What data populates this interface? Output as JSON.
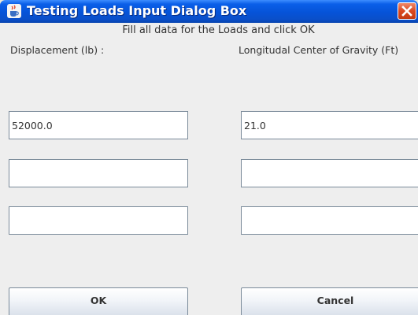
{
  "window": {
    "title": "Testing Loads Input Dialog Box",
    "title_icon": "java-cup-icon",
    "close_icon": "close-icon",
    "colors": {
      "titlebar": "#0653d8",
      "close": "#d9471f",
      "content": "#eeeeee"
    }
  },
  "form": {
    "instruction": "Fill all data for the Loads and click OK",
    "columns": {
      "displacement": {
        "label": "Displacement (lb) :"
      },
      "lcg": {
        "label": "Longitudal Center of Gravity (Ft)"
      }
    },
    "rows": [
      {
        "displacement": "52000.0",
        "lcg": "21.0"
      },
      {
        "displacement": "",
        "lcg": ""
      },
      {
        "displacement": "",
        "lcg": ""
      }
    ]
  },
  "buttons": {
    "ok": "OK",
    "cancel": "Cancel"
  }
}
